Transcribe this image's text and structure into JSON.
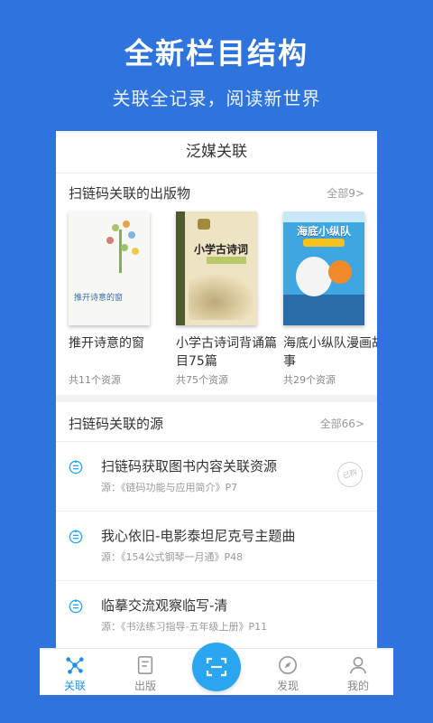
{
  "hero": {
    "title": "全新栏目结构",
    "subtitle": "关联全记录，阅读新世界"
  },
  "panel": {
    "header": "泛媒关联",
    "publications": {
      "title": "扫链码关联的出版物",
      "more": "全部9>",
      "books": [
        {
          "title": "推开诗意的窗",
          "count": "共11个资源",
          "cover_text": "推开诗意的窗"
        },
        {
          "title": "小学古诗词背诵篇目75篇",
          "count": "共75个资源",
          "cover_text": "小学古诗词"
        },
        {
          "title": "海底小纵队漫画故事",
          "count": "共29个资源",
          "cover_text": "海底小纵队"
        }
      ]
    },
    "sources": {
      "title": "扫链码关联的源",
      "more": "全部66>",
      "items": [
        {
          "title": "扫链码获取图书内容关联资源",
          "meta": "源：《链码功能与应用简介》P7",
          "stamp": "已购"
        },
        {
          "title": "我心依旧-电影泰坦尼克号主题曲",
          "meta": "源：《154公式钢琴一月通》P48"
        },
        {
          "title": "临摹交流观察临写-清",
          "meta": "源：《书法练习指导-五年级上册》P11"
        }
      ]
    }
  },
  "tabbar": {
    "tabs": [
      {
        "label": "关联",
        "icon": "link-nodes-icon",
        "active": true
      },
      {
        "label": "出版",
        "icon": "book-icon",
        "active": false
      },
      {
        "label": "",
        "icon": "scan-icon",
        "active": false
      },
      {
        "label": "发现",
        "icon": "compass-icon",
        "active": false
      },
      {
        "label": "我的",
        "icon": "user-icon",
        "active": false
      }
    ]
  },
  "colors": {
    "background": "#2f73dc",
    "accent": "#2aa6f0",
    "active_tab": "#1f8ee6"
  }
}
